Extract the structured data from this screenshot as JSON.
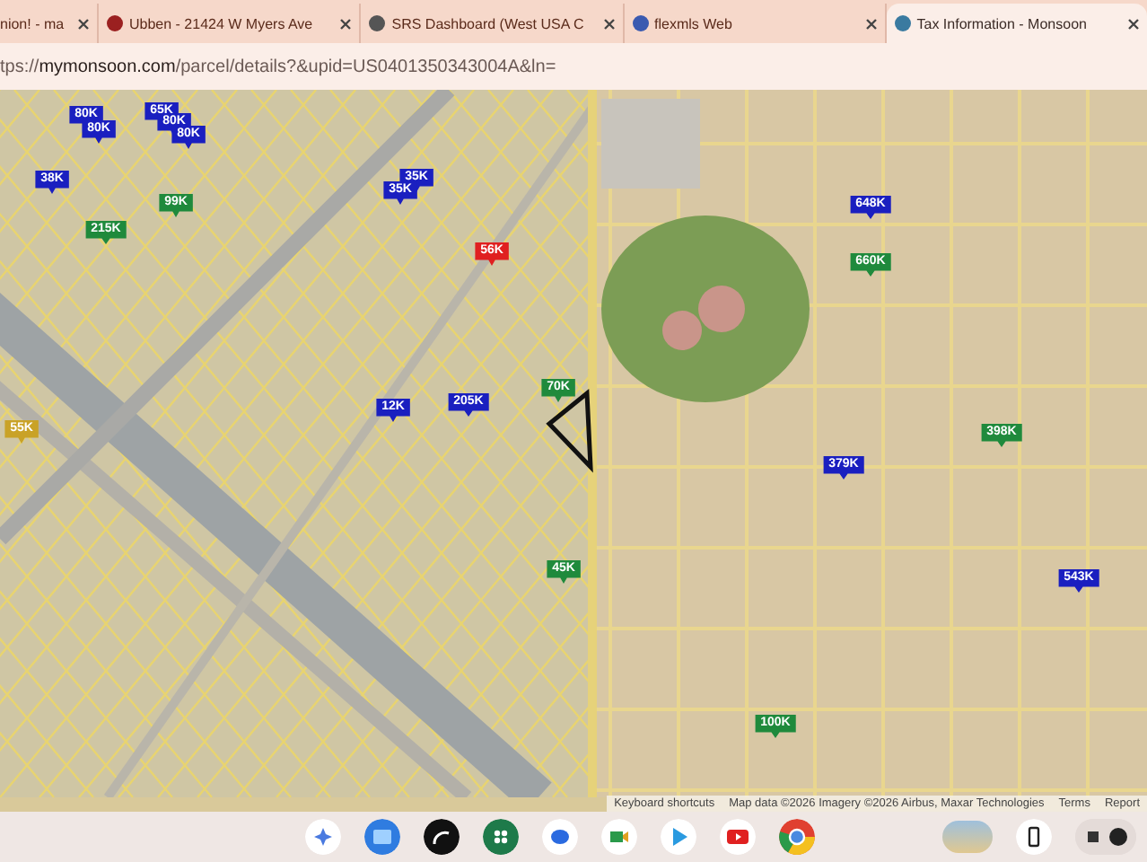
{
  "tabs": [
    {
      "title": "nion! - ma",
      "selected": false
    },
    {
      "title": "Ubben - 21424 W Myers Ave",
      "selected": false
    },
    {
      "title": "SRS Dashboard (West USA C",
      "selected": false
    },
    {
      "title": "flexmls Web",
      "selected": false
    },
    {
      "title": "Tax Information - Monsoon",
      "selected": true
    }
  ],
  "address_bar": {
    "url": "tps://**mymonsoon.com**/parcel/details?&upid=US0401350343004A&ln="
  },
  "map": {
    "pins": [
      {
        "label": "65K",
        "color": "#1a1fc0"
      },
      {
        "label": "80K",
        "color": "#1a1fc0"
      },
      {
        "label": "80K",
        "color": "#1a1fc0"
      },
      {
        "label": "80K",
        "color": "#1a1fc0"
      },
      {
        "label": "80K",
        "color": "#1a1fc0"
      },
      {
        "label": "35K",
        "color": "#1a1fc0"
      },
      {
        "label": "38K",
        "color": "#1a1fc0"
      },
      {
        "label": "35K",
        "color": "#1a1fc0"
      },
      {
        "label": "99K",
        "color": "#1f8a3c"
      },
      {
        "label": "648K",
        "color": "#1a1fc0"
      },
      {
        "label": "215K",
        "color": "#1f8a3c"
      },
      {
        "label": "56K",
        "color": "#e02020"
      },
      {
        "label": "660K",
        "color": "#1f8a3c"
      },
      {
        "label": "70K",
        "color": "#1f8a3c"
      },
      {
        "label": "205K",
        "color": "#1a1fc0"
      },
      {
        "label": "12K",
        "color": "#1a1fc0"
      },
      {
        "label": "55K",
        "color": "#c9a227"
      },
      {
        "label": "398K",
        "color": "#1f8a3c"
      },
      {
        "label": "379K",
        "color": "#1a1fc0"
      },
      {
        "label": "45K",
        "color": "#1f8a3c"
      },
      {
        "label": "543K",
        "color": "#1a1fc0"
      },
      {
        "label": "100K",
        "color": "#1f8a3c"
      }
    ],
    "attribution": [
      "Keyboard shortcuts",
      "Map data ©2026 Imagery ©2026 Airbus, Maxar Technologies",
      "Terms",
      "Report"
    ]
  }
}
